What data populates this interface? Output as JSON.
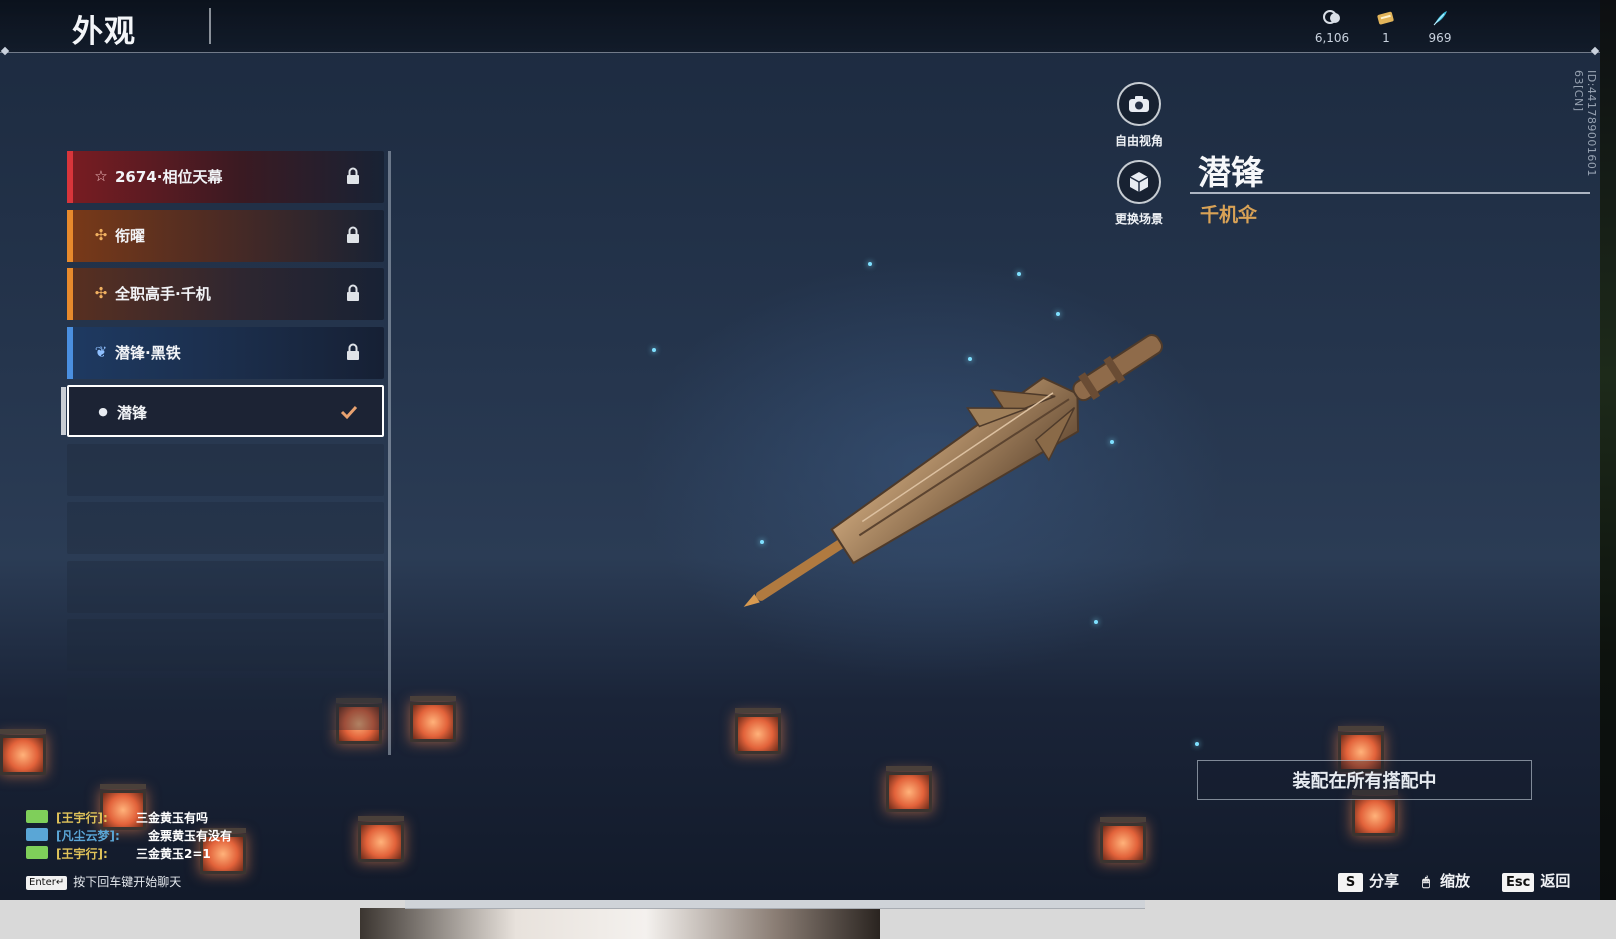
{
  "header": {
    "title": "外观"
  },
  "currencies": [
    {
      "icon": "coin-stack-icon",
      "value": "6,106"
    },
    {
      "icon": "ticket-icon",
      "value": "1"
    },
    {
      "icon": "feather-icon",
      "value": "969"
    }
  ],
  "side_actions": {
    "free_view": "自由视角",
    "change_scene": "更换场景"
  },
  "item": {
    "name": "潜锋",
    "type": "千机伞",
    "id_label": "ID:441789001601 63[CN]"
  },
  "list": [
    {
      "label": "2674·相位天幕",
      "icon": "star-outline-icon",
      "rarity_color": "#d8353b",
      "locked": true
    },
    {
      "label": "衔曜",
      "icon": "rune-orange-icon",
      "rarity_color": "#e88a2c",
      "locked": true
    },
    {
      "label": "全职高手·千机",
      "icon": "rune-orange-icon",
      "rarity_color": "#e88a2c",
      "locked": true
    },
    {
      "label": "潜锋·黑铁",
      "icon": "wings-icon",
      "rarity_color": "#4a8fe0",
      "locked": true
    },
    {
      "label": "潜锋",
      "icon": "drop-icon",
      "rarity_color": "#c8cdd4",
      "selected": true
    }
  ],
  "equip_button": "装配在所有搭配中",
  "chat": [
    {
      "who": "[王宇行]:",
      "who_color": "#e0c35a",
      "msg": "三金黄玉有吗"
    },
    {
      "who": "[凡尘云梦]:",
      "who_color": "#5aa6d6",
      "msg": "金票黄玉有没有"
    },
    {
      "who": "[王宇行]:",
      "who_color": "#e0c35a",
      "msg": "三金黄玉2=1"
    }
  ],
  "chat_hint": {
    "key": "Enter↵",
    "text": "按下回车键开始聊天"
  },
  "hints": [
    {
      "key": "S",
      "label": "分享"
    },
    {
      "key": "🖱",
      "label": "缩放"
    },
    {
      "key": "Esc",
      "label": "返回"
    }
  ]
}
